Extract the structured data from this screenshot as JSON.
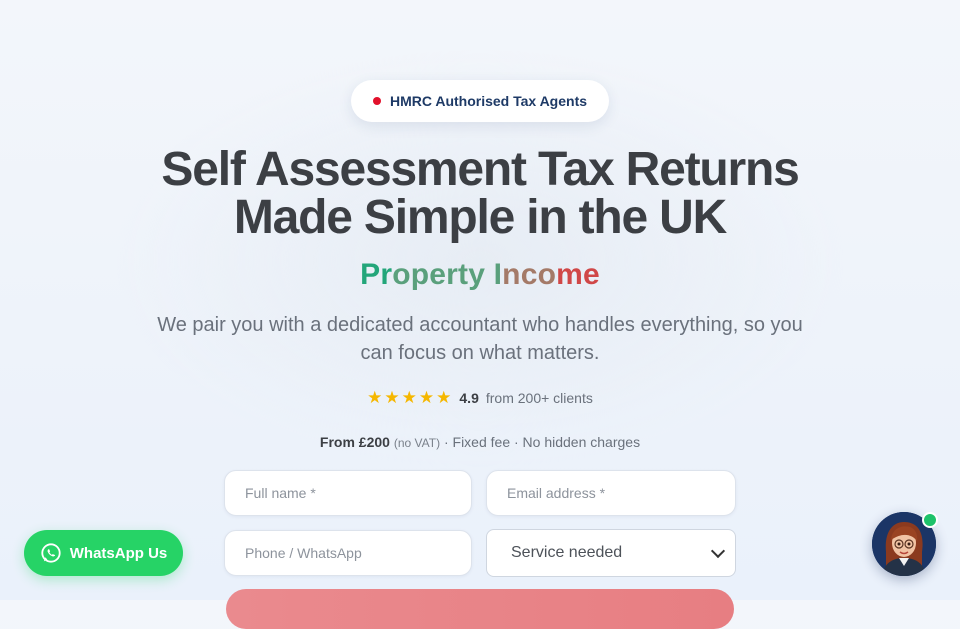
{
  "badge": {
    "label": "HMRC Authorised Tax Agents",
    "dot_color": "#e2112b"
  },
  "hero": {
    "title_line1": "Self Assessment Tax Returns",
    "title_line2": "Made Simple in the UK",
    "rotating_word": [
      "Pr",
      "operty I",
      "nco",
      "me"
    ],
    "description": "We pair you with a dedicated accountant who handles everything, so you can focus on what matters."
  },
  "rating": {
    "stars": 5,
    "score": "4.9",
    "text": "from 200+ clients",
    "star_color": "#f5b700"
  },
  "pricing": {
    "amount": "From £200",
    "vat": "(no VAT)",
    "details": " · Fixed fee · No hidden charges"
  },
  "form": {
    "name_placeholder": "Full name *",
    "email_placeholder": "Email address *",
    "phone_placeholder": "Phone / WhatsApp",
    "service_selected": "Service needed"
  },
  "whatsapp": {
    "label": "WhatsApp Us",
    "color": "#26d366"
  },
  "icons": {
    "whatsapp": "whatsapp-icon",
    "chat_avatar": "assistant-avatar",
    "select": "chevron-down-icon"
  }
}
